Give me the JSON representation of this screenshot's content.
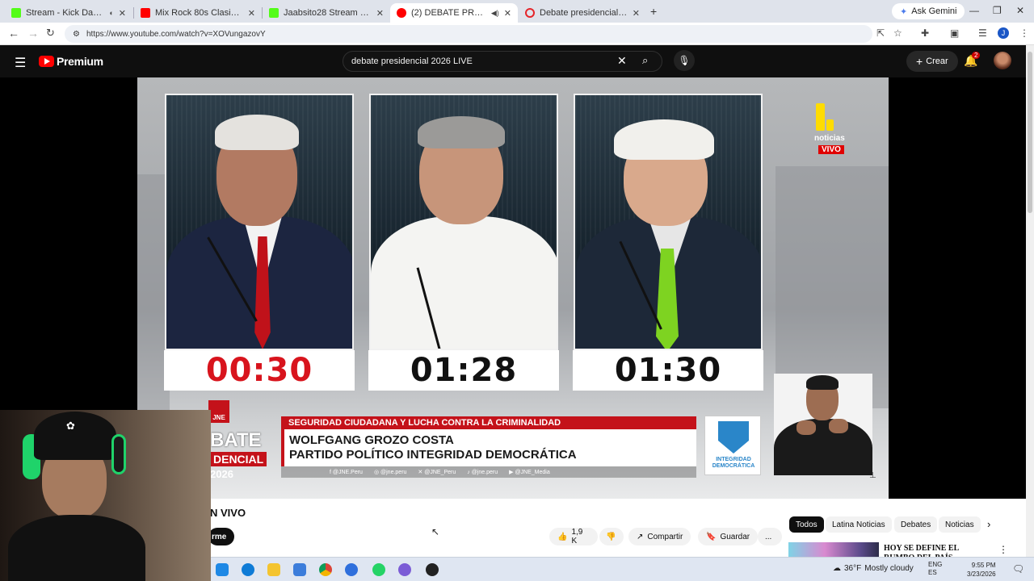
{
  "browser": {
    "tabs": [
      {
        "title": "Stream - Kick Dashboard",
        "favicon_color": "#53fc18",
        "active": false
      },
      {
        "title": "Mix Rock 80s Clasicos 2021 dj...",
        "favicon_color": "#ff0000",
        "active": false
      },
      {
        "title": "Jaabsito28 Stream - Watch Live",
        "favicon_color": "#53fc18",
        "active": false
      },
      {
        "title": "(2) DEBATE PRESIDENCIAL",
        "favicon_color": "#ff0000",
        "active": true
      },
      {
        "title": "Debate presidencial: estos son...",
        "favicon_color": "#e5252a",
        "active": false
      }
    ],
    "new_tab": "+",
    "ask_gemini": "Ask Gemini",
    "url": "https://www.youtube.com/watch?v=XOVungazovY",
    "profile_initial": "J"
  },
  "youtube": {
    "brand": "Premium",
    "search_value": "debate presidencial 2026 LIVE",
    "create_label": "Crear",
    "notification_count": "2"
  },
  "video": {
    "timers": [
      "00:30",
      "01:28",
      "01:30"
    ],
    "channel_logo": {
      "name": "noticias",
      "live": "VIVO"
    },
    "topic": "SEGURIDAD CIUDADANA Y LUCHA CONTRA LA CRIMINALIDAD",
    "candidate_line1": "WOLFGANG GROZO COSTA",
    "candidate_line2": "PARTIDO POLÍTICO INTEGRIDAD DEMOCRÁTICA",
    "party_logo_text": "INTEGRIDAD DEMOCRÁTICA",
    "socials": [
      "@JNE.Peru",
      "@jne.peru",
      "@JNE_Peru",
      "@jne.peru",
      "@JNE_Media"
    ],
    "debate_brand": {
      "l1": "BATE",
      "l2": "DENCIAL",
      "l3": "2026"
    },
    "jne_mark": "JNE"
  },
  "below": {
    "title_fragment": "N VIVO",
    "subscribe_fragment": "rme",
    "likes": "1,9 K",
    "share": "Compartir",
    "save": "Guardar",
    "more": "...",
    "chips": [
      "Todos",
      "Latina Noticias",
      "Debates",
      "Noticias"
    ],
    "rec_title": "HOY SE DEFINE EL RUMBO DEL PAÍS"
  },
  "taskbar": {
    "temp": "36°F",
    "weather": "Mostly cloudy",
    "lang1": "ENG",
    "lang2": "ES",
    "time": "9:55 PM",
    "date": "3/23/2026"
  }
}
